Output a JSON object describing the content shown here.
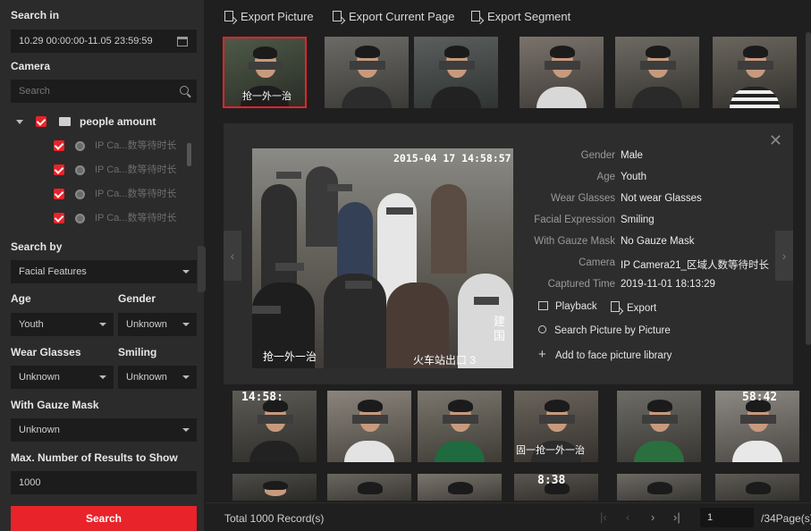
{
  "left_panel": {
    "search_in_label": "Search in",
    "date_range": "10.29 00:00:00-11.05 23:59:59",
    "camera_label": "Camera",
    "camera_search_placeholder": "Search",
    "tree_root": "people amount",
    "cameras": [
      "IP Ca...数等待时长",
      "IP Ca...数等待时长",
      "IP Ca...数等待时长",
      "IP Ca...数等待时长"
    ],
    "search_by_label": "Search by",
    "search_by_value": "Facial Features",
    "age_label": "Age",
    "age_value": "Youth",
    "gender_label": "Gender",
    "gender_value": "Unknown",
    "wear_glasses_label": "Wear Glasses",
    "wear_glasses_value": "Unknown",
    "smiling_label": "Smiling",
    "smiling_value": "Unknown",
    "gauze_label": "With Gauze Mask",
    "gauze_value": "Unknown",
    "max_results_label": "Max. Number of Results to Show",
    "max_results_value": "1000",
    "search_button": "Search"
  },
  "toolbar": {
    "export_picture": "Export Picture",
    "export_current_page": "Export Current Page",
    "export_segment": "Export Segment"
  },
  "thumb_overlays": {
    "first_caption": "抢一外一治",
    "row2_ts1": "14:58:",
    "row2_ts5": "58:42",
    "row2_caption3": "固一抢一外一治",
    "row3_ts": "8:38"
  },
  "detail": {
    "photo_timestamp": "2015-04 17 14:58:57",
    "photo_caption_left": "抢一外一治",
    "photo_caption_right": "火车站出口 3",
    "photo_vertical_text": "建国",
    "fields": [
      {
        "key": "Gender",
        "value": "Male"
      },
      {
        "key": "Age",
        "value": "Youth"
      },
      {
        "key": "Wear Glasses",
        "value": "Not wear Glasses"
      },
      {
        "key": "Facial Expression",
        "value": "Smiling"
      },
      {
        "key": "With Gauze Mask",
        "value": "No Gauze Mask"
      },
      {
        "key": "Camera",
        "value": "IP Camera21_区域人数等待时长"
      },
      {
        "key": "Captured Time",
        "value": "2019-11-01 18:13:29"
      }
    ],
    "playback": "Playback",
    "export": "Export",
    "search_by_picture": "Search Picture by Picture",
    "add_to_library": "Add to face picture library"
  },
  "footer": {
    "total": "Total 1000 Record(s)",
    "page_value": "1",
    "page_total": "/34Page(s)"
  },
  "colors": {
    "accent": "#e8232a",
    "panel": "#2b2b2b",
    "background": "#1f1f1f"
  }
}
